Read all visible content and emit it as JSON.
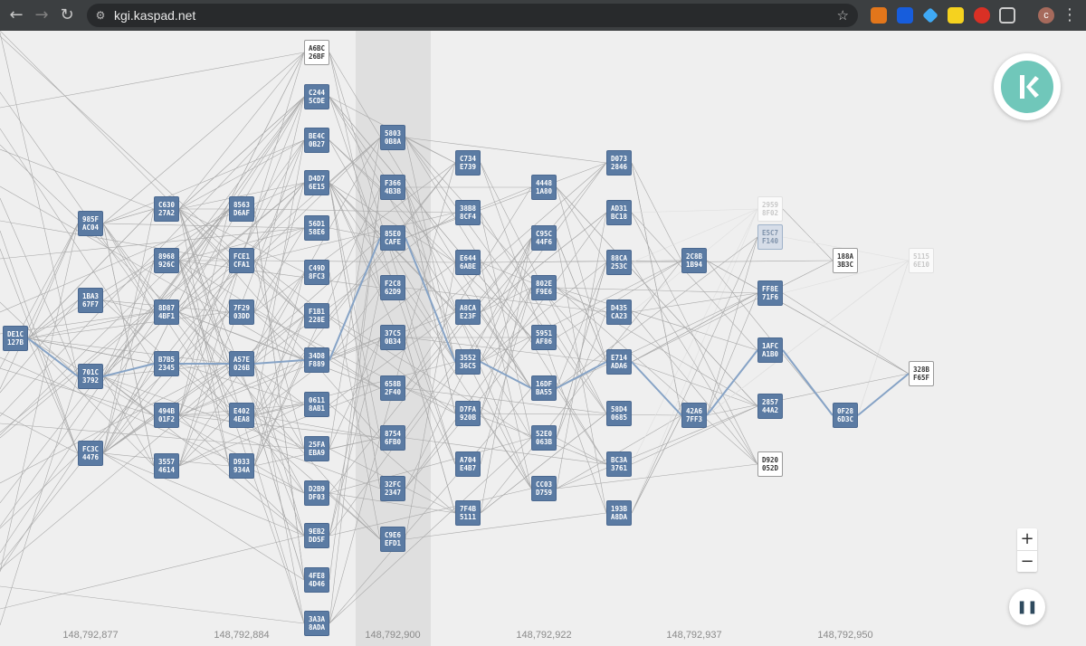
{
  "browser": {
    "url": "kgi.kaspad.net",
    "back_icon": "←",
    "forward_icon": "→",
    "reload_icon": "↻",
    "star_icon": "☆",
    "menu_icon": "⋮",
    "avatar_letter": "c",
    "extensions": [
      "metamask-icon",
      "bitwarden-icon",
      "gem-icon",
      "dollar-icon",
      "shield-icon",
      "puzzle-icon"
    ]
  },
  "graph": {
    "blue_score_labels": [
      "148,792,877",
      "148,792,884",
      "148,792,900",
      "148,792,922",
      "148,792,937",
      "148,792,950"
    ],
    "blocks": [
      {
        "id": "DE1C",
        "l2": "127B",
        "style": "blue"
      },
      {
        "id": "985F",
        "l2": "AC04",
        "style": "blue"
      },
      {
        "id": "1BA3",
        "l2": "67F7",
        "style": "blue"
      },
      {
        "id": "701C",
        "l2": "3792",
        "style": "blue"
      },
      {
        "id": "FC3C",
        "l2": "4476",
        "style": "blue"
      },
      {
        "id": "C630",
        "l2": "27A2",
        "style": "blue"
      },
      {
        "id": "8968",
        "l2": "926C",
        "style": "blue"
      },
      {
        "id": "8D87",
        "l2": "4BF1",
        "style": "blue"
      },
      {
        "id": "B7B5",
        "l2": "2345",
        "style": "blue"
      },
      {
        "id": "494B",
        "l2": "01F2",
        "style": "blue"
      },
      {
        "id": "3557",
        "l2": "4614",
        "style": "blue"
      },
      {
        "id": "8563",
        "l2": "D6AF",
        "style": "blue"
      },
      {
        "id": "FCE1",
        "l2": "CFA1",
        "style": "blue"
      },
      {
        "id": "7F29",
        "l2": "03DD",
        "style": "blue"
      },
      {
        "id": "A57E",
        "l2": "026B",
        "style": "blue"
      },
      {
        "id": "E402",
        "l2": "4EA8",
        "style": "blue"
      },
      {
        "id": "D933",
        "l2": "934A",
        "style": "blue"
      },
      {
        "id": "A6BC",
        "l2": "26BF",
        "style": "white"
      },
      {
        "id": "C244",
        "l2": "5CDE",
        "style": "blue"
      },
      {
        "id": "BE4C",
        "l2": "0B27",
        "style": "blue"
      },
      {
        "id": "D4D7",
        "l2": "6E15",
        "style": "blue"
      },
      {
        "id": "56D1",
        "l2": "58E6",
        "style": "blue"
      },
      {
        "id": "C49D",
        "l2": "8FC3",
        "style": "blue"
      },
      {
        "id": "F1B1",
        "l2": "228E",
        "style": "blue"
      },
      {
        "id": "34D8",
        "l2": "F889",
        "style": "blue"
      },
      {
        "id": "0611",
        "l2": "8AB1",
        "style": "blue"
      },
      {
        "id": "25FA",
        "l2": "EBA9",
        "style": "blue"
      },
      {
        "id": "D2B9",
        "l2": "DF03",
        "style": "blue"
      },
      {
        "id": "9EB2",
        "l2": "DD5F",
        "style": "blue"
      },
      {
        "id": "4FE8",
        "l2": "4D46",
        "style": "blue"
      },
      {
        "id": "3A3A",
        "l2": "8ADA",
        "style": "blue"
      },
      {
        "id": "5803",
        "l2": "0B8A",
        "style": "blue"
      },
      {
        "id": "F366",
        "l2": "4B3B",
        "style": "blue"
      },
      {
        "id": "85E0",
        "l2": "CAFE",
        "style": "blue"
      },
      {
        "id": "F2C8",
        "l2": "62D9",
        "style": "blue"
      },
      {
        "id": "37C5",
        "l2": "0B34",
        "style": "blue"
      },
      {
        "id": "658B",
        "l2": "2F40",
        "style": "blue"
      },
      {
        "id": "8754",
        "l2": "6FB0",
        "style": "blue"
      },
      {
        "id": "32FC",
        "l2": "2347",
        "style": "blue"
      },
      {
        "id": "C9E6",
        "l2": "EFD1",
        "style": "blue"
      },
      {
        "id": "C734",
        "l2": "E739",
        "style": "blue"
      },
      {
        "id": "38B8",
        "l2": "8CF4",
        "style": "blue"
      },
      {
        "id": "E644",
        "l2": "6ABE",
        "style": "blue"
      },
      {
        "id": "A8CA",
        "l2": "E23F",
        "style": "blue"
      },
      {
        "id": "3552",
        "l2": "36C5",
        "style": "blue"
      },
      {
        "id": "D7FA",
        "l2": "920B",
        "style": "blue"
      },
      {
        "id": "A704",
        "l2": "E4B7",
        "style": "blue"
      },
      {
        "id": "7F4B",
        "l2": "5111",
        "style": "blue"
      },
      {
        "id": "4448",
        "l2": "1A80",
        "style": "blue"
      },
      {
        "id": "C95C",
        "l2": "44F6",
        "style": "blue"
      },
      {
        "id": "802E",
        "l2": "F9E6",
        "style": "blue"
      },
      {
        "id": "5951",
        "l2": "AF86",
        "style": "blue"
      },
      {
        "id": "16DF",
        "l2": "BA55",
        "style": "blue"
      },
      {
        "id": "52E0",
        "l2": "063B",
        "style": "blue"
      },
      {
        "id": "CC03",
        "l2": "D759",
        "style": "blue"
      },
      {
        "id": "D073",
        "l2": "2846",
        "style": "blue"
      },
      {
        "id": "AD31",
        "l2": "BC18",
        "style": "blue"
      },
      {
        "id": "88CA",
        "l2": "253C",
        "style": "blue"
      },
      {
        "id": "D435",
        "l2": "CA23",
        "style": "blue"
      },
      {
        "id": "E714",
        "l2": "ADA6",
        "style": "blue"
      },
      {
        "id": "58D4",
        "l2": "0685",
        "style": "blue"
      },
      {
        "id": "BC3A",
        "l2": "3761",
        "style": "blue"
      },
      {
        "id": "193B",
        "l2": "A8DA",
        "style": "blue"
      },
      {
        "id": "2C8B",
        "l2": "1B94",
        "style": "blue"
      },
      {
        "id": "42A6",
        "l2": "7FF3",
        "style": "blue"
      },
      {
        "id": "2959",
        "l2": "8F02",
        "style": "ghost"
      },
      {
        "id": "E5C7",
        "l2": "F140",
        "style": "lightblue"
      },
      {
        "id": "FF8E",
        "l2": "71F6",
        "style": "blue"
      },
      {
        "id": "1AFC",
        "l2": "A1B0",
        "style": "blue"
      },
      {
        "id": "2857",
        "l2": "44A2",
        "style": "blue"
      },
      {
        "id": "D920",
        "l2": "052D",
        "style": "white"
      },
      {
        "id": "188A",
        "l2": "3B3C",
        "style": "white"
      },
      {
        "id": "0F28",
        "l2": "6D3C",
        "style": "blue"
      },
      {
        "id": "5115",
        "l2": "6E10",
        "style": "ghost"
      },
      {
        "id": "328B",
        "l2": "F65F",
        "style": "white"
      }
    ],
    "selected_chain": [
      "DE1C",
      "701C",
      "B7B5",
      "A57E",
      "34D8",
      "85E0",
      "3552",
      "16DF",
      "E714",
      "42A6",
      "1AFC",
      "0F28",
      "328B"
    ]
  },
  "controls": {
    "zoom_in": "+",
    "zoom_out": "−",
    "pause_icon": "❚❚"
  },
  "colors": {
    "block_blue": "#5b7ba3",
    "logo_teal": "#70c7ba",
    "chain_edge": "#86a3c6",
    "edge": "#a8a8a8"
  }
}
